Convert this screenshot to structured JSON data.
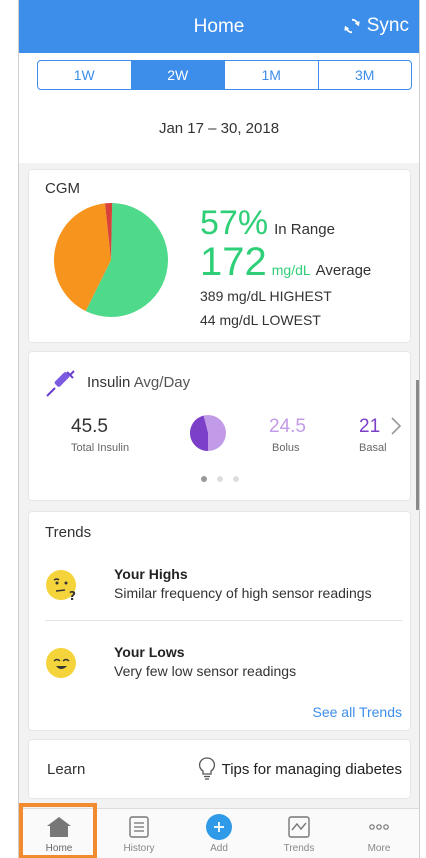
{
  "header": {
    "title": "Home",
    "sync_label": "Sync"
  },
  "range": {
    "options": [
      "1W",
      "2W",
      "1M",
      "3M"
    ],
    "selected": "2W",
    "date_range": "Jan 17 – 30, 2018"
  },
  "cgm": {
    "label": "CGM",
    "in_range_pct": "57%",
    "in_range_label": "In Range",
    "average_value": "172",
    "average_unit": "mg/dL",
    "average_label": "Average",
    "highest": "389 mg/dL HIGHEST",
    "lowest": "44 mg/dL LOWEST",
    "pie_fractions": {
      "in_range": 0.57,
      "high": 0.41,
      "low": 0.02
    },
    "colors": {
      "in_range": "#4fd98a",
      "high": "#f7941d",
      "low": "#d9413b"
    }
  },
  "insulin": {
    "title": "Insulin",
    "subtitle": "Avg/Day",
    "total_value": "45.5",
    "total_label": "Total Insulin",
    "bolus_value": "24.5",
    "bolus_label": "Bolus",
    "basal_value": "21",
    "basal_label": "Basal",
    "bolus_fraction": 0.54,
    "colors": {
      "bolus": "#c29be8",
      "basal": "#7b3fc8"
    },
    "page_index": 0,
    "page_count": 3
  },
  "trends": {
    "label": "Trends",
    "items": [
      {
        "title": "Your Highs",
        "desc": "Similar frequency of high sensor readings",
        "icon": "thinking-face-icon"
      },
      {
        "title": "Your Lows",
        "desc": "Very few low sensor readings",
        "icon": "smiling-face-icon"
      }
    ],
    "see_all": "See all Trends"
  },
  "learn": {
    "label": "Learn",
    "tip": "Tips for managing diabetes"
  },
  "tabs": [
    {
      "label": "Home",
      "icon": "home-icon",
      "active": true
    },
    {
      "label": "History",
      "icon": "list-icon",
      "active": false
    },
    {
      "label": "Add",
      "icon": "plus-icon",
      "active": false
    },
    {
      "label": "Trends",
      "icon": "trend-chart-icon",
      "active": false
    },
    {
      "label": "More",
      "icon": "more-dots-icon",
      "active": false
    }
  ],
  "accent_color": "#3d8eea"
}
